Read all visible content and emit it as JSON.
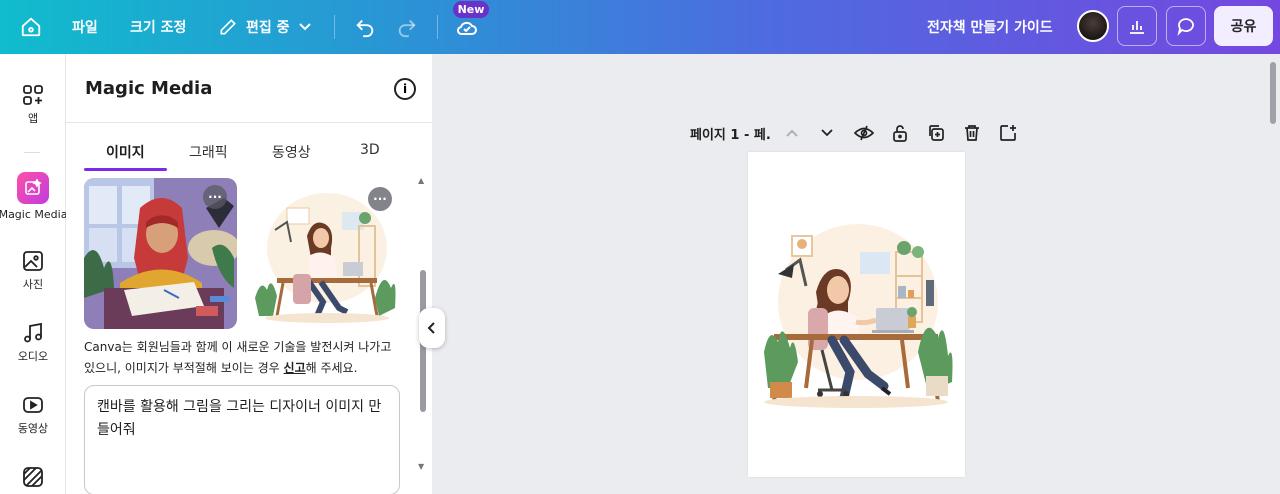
{
  "topbar": {
    "file_label": "파일",
    "resize_label": "크기 조정",
    "edit_mode_label": "편집 중",
    "new_badge": "New",
    "doc_title": "전자책 만들기 가이드",
    "share_label": "공유"
  },
  "rail": {
    "items": [
      {
        "label": "앱",
        "icon": "apps-icon"
      },
      {
        "label": "Magic Media",
        "icon": "magic-media-icon"
      },
      {
        "label": "사진",
        "icon": "photo-icon"
      },
      {
        "label": "오디오",
        "icon": "audio-icon"
      },
      {
        "label": "동영상",
        "icon": "video-icon"
      }
    ]
  },
  "panel": {
    "title": "Magic Media",
    "tabs": [
      "이미지",
      "그래픽",
      "동영상",
      "3D"
    ],
    "active_tab": 0,
    "disclaimer_before": "Canva는 회원님들과 함께 이 새로운 기술을 발전시켜 나가고 있으니, 이미지가 부적절해 보이는 경우 ",
    "disclaimer_link": "신고",
    "disclaimer_after": "해 주세요.",
    "prompt_text": "캔바를 활용해 그림을 그리는 디자이너 이미지 만들어줘"
  },
  "canvas": {
    "page_label": "페이지 1 - 페."
  },
  "colors": {
    "accent": "#7d2ae8",
    "topbar_start": "#10bccd",
    "topbar_end": "#7448e0"
  }
}
